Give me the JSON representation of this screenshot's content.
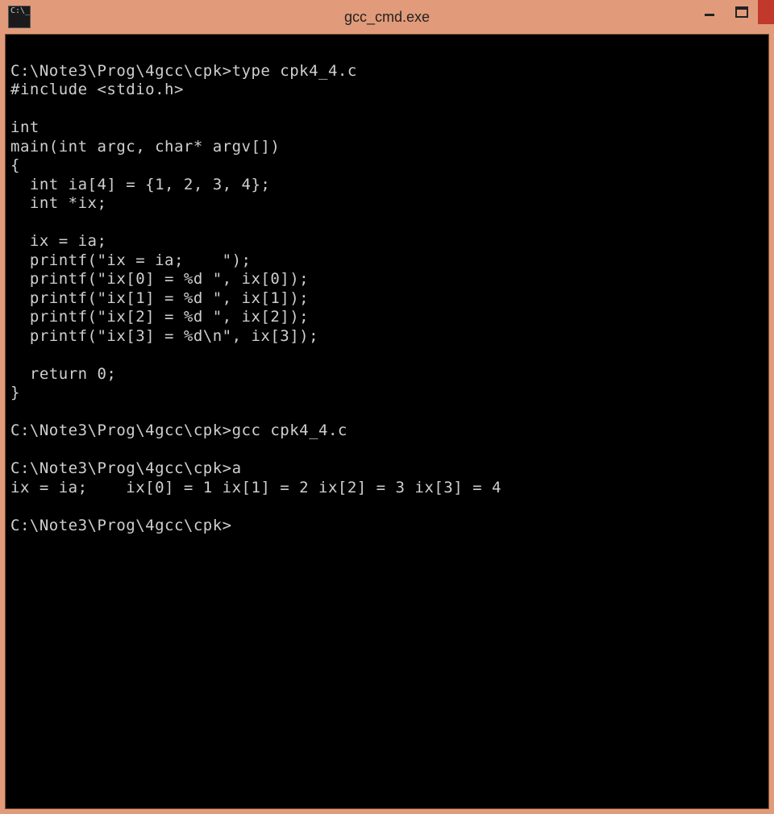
{
  "window": {
    "title": "gcc_cmd.exe"
  },
  "terminal": {
    "content": "\nC:\\Note3\\Prog\\4gcc\\cpk>type cpk4_4.c\n#include <stdio.h>\n\nint\nmain(int argc, char* argv[])\n{\n  int ia[4] = {1, 2, 3, 4};\n  int *ix;\n\n  ix = ia;\n  printf(\"ix = ia;    \");\n  printf(\"ix[0] = %d \", ix[0]);\n  printf(\"ix[1] = %d \", ix[1]);\n  printf(\"ix[2] = %d \", ix[2]);\n  printf(\"ix[3] = %d\\n\", ix[3]);\n\n  return 0;\n}\n\nC:\\Note3\\Prog\\4gcc\\cpk>gcc cpk4_4.c\n\nC:\\Note3\\Prog\\4gcc\\cpk>a\nix = ia;    ix[0] = 1 ix[1] = 2 ix[2] = 3 ix[3] = 4\n\nC:\\Note3\\Prog\\4gcc\\cpk>"
  }
}
